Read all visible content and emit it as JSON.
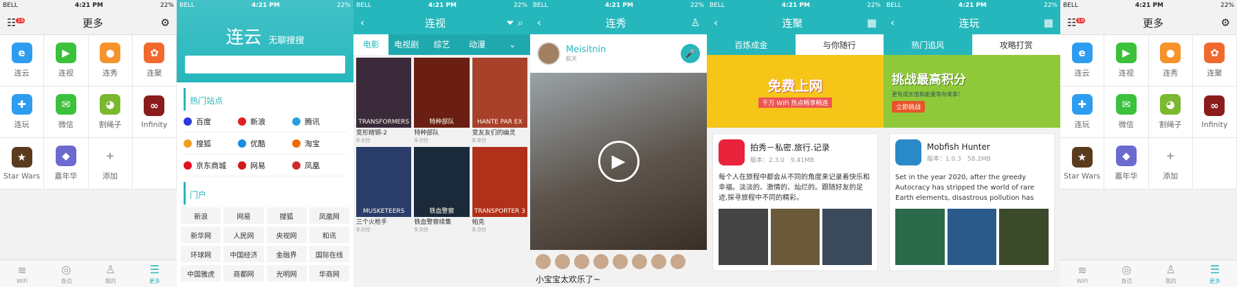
{
  "status": {
    "carrier": "BELL",
    "time": "4:21 PM",
    "battery": "22%"
  },
  "s1": {
    "title": "更多",
    "badge": "19",
    "apps": [
      {
        "label": "连云",
        "color": "#2e9df0",
        "glyph": "e"
      },
      {
        "label": "连视",
        "color": "#3cc13c",
        "glyph": "▶"
      },
      {
        "label": "连秀",
        "color": "#f6932a",
        "glyph": "●"
      },
      {
        "label": "连聚",
        "color": "#f06a2e",
        "glyph": "✿"
      },
      {
        "label": "连玩",
        "color": "#2e9df0",
        "glyph": "✚"
      },
      {
        "label": "微信",
        "color": "#3cc13c",
        "glyph": "✉"
      },
      {
        "label": "割绳子",
        "color": "#7ab830",
        "glyph": "◕"
      },
      {
        "label": "Infinity",
        "color": "#8a1c1c",
        "glyph": "∞"
      },
      {
        "label": "Star Wars",
        "color": "#5a3b1e",
        "glyph": "★"
      },
      {
        "label": "嘉年华",
        "color": "#6a6ad0",
        "glyph": "◆"
      },
      {
        "label": "添加",
        "color": "transparent",
        "glyph": "+"
      }
    ],
    "tabs": [
      {
        "label": "WiFi",
        "glyph": "≋"
      },
      {
        "label": "身边",
        "glyph": "◎"
      },
      {
        "label": "我的",
        "glyph": "♙"
      },
      {
        "label": "更多",
        "glyph": "☰"
      }
    ]
  },
  "s2": {
    "title": "连云",
    "subtitle": "无聊搜搜",
    "hot_title": "热门站点",
    "sites": [
      {
        "label": "百度",
        "color": "#2d3ad8"
      },
      {
        "label": "新浪",
        "color": "#e02020"
      },
      {
        "label": "腾讯",
        "color": "#2a9fe0"
      },
      {
        "label": "搜狐",
        "color": "#f0a020"
      },
      {
        "label": "优酷",
        "color": "#1a8de0"
      },
      {
        "label": "淘宝",
        "color": "#f06a00"
      },
      {
        "label": "京东商城",
        "color": "#e01020"
      },
      {
        "label": "网易",
        "color": "#d01818"
      },
      {
        "label": "凤凰",
        "color": "#d02a2a"
      }
    ],
    "portal_title": "门户",
    "portals": [
      "新浪",
      "网易",
      "搜狐",
      "凤凰网",
      "新华网",
      "人民网",
      "央视网",
      "和讯",
      "环球网",
      "中国经济",
      "金融界",
      "国际在线",
      "中国雅虎",
      "商都网",
      "光明网",
      "华商网"
    ]
  },
  "s3": {
    "title": "连视",
    "tabs": [
      "电影",
      "电视剧",
      "综艺",
      "动漫"
    ],
    "movies": [
      {
        "name": "变形精钢-2",
        "score": "9.6分",
        "color": "#3a2a3a",
        "poster": "TRANSFORMERS"
      },
      {
        "name": "特种部队",
        "score": "9.0分",
        "color": "#6a1f12",
        "poster": "特种部队"
      },
      {
        "name": "变友友们的幽灵",
        "score": "8.8分",
        "color": "#a8402a",
        "poster": "HANTE PAR EX"
      },
      {
        "name": "三个火枪手",
        "score": "9.0分",
        "color": "#2a3d6a",
        "poster": "MUSKETEERS"
      },
      {
        "name": "铁血警察续集",
        "score": "9.0分",
        "color": "#1a2a3a",
        "poster": "铁血警察"
      },
      {
        "name": "帕克",
        "score": "8.0分",
        "color": "#b0301a",
        "poster": "TRANSPORTER 3"
      }
    ]
  },
  "s4": {
    "title": "连秀",
    "user": "Meisitnin",
    "sub": "航天",
    "caption": "小宝宝太欢乐了~"
  },
  "s5": {
    "title": "连聚",
    "tabs": [
      "百炼成金",
      "与你随行"
    ],
    "banner": "免费上网",
    "banner_sub": "千万 WiFi 热点畅享畅连",
    "app": {
      "name": "拍秀－私密.旅行.记录",
      "meta": "版本：2.3.0　9.41MB",
      "desc": "每个人在旅程中都会从不同的角度来记录着快乐和幸福。淡淡的、激情的、灿烂的。跟随好友的足迹,探寻旅程中不同的精彩。"
    }
  },
  "s6": {
    "title": "连玩",
    "tabs": [
      "热门追风",
      "攻略打赏"
    ],
    "banner": "挑战最高积分",
    "banner_sub": "更有成长值和能量等你来拿！",
    "banner_btn": "立即挑战",
    "app": {
      "name": "Mobfish Hunter",
      "meta": "版本：1.0.3　58.2MB",
      "desc": "Set in the year 2020, after the greedy Autocracy has stripped the world of rare Earth elements, disastrous pollution has"
    }
  }
}
